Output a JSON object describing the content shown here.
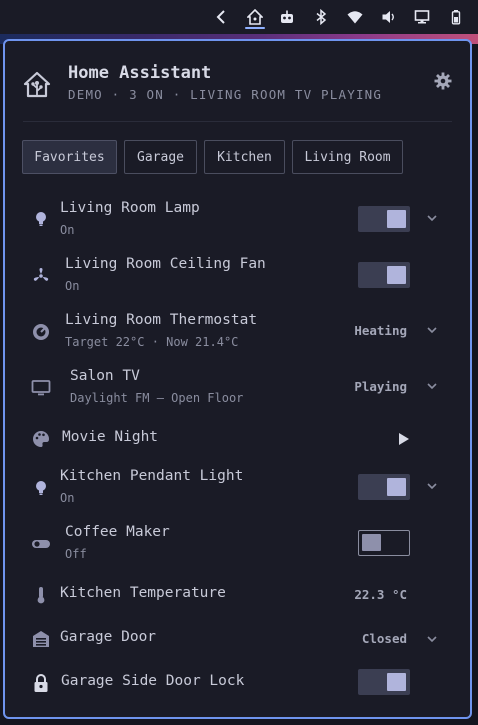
{
  "panel": {
    "title": "Home Assistant",
    "subtitle": "DEMO · 3 ON · LIVING ROOM TV PLAYING"
  },
  "tabs": [
    {
      "label": "Favorites",
      "active": true
    },
    {
      "label": "Garage",
      "active": false
    },
    {
      "label": "Kitchen",
      "active": false
    },
    {
      "label": "Living Room",
      "active": false
    }
  ],
  "entities": [
    {
      "icon": "lightbulb-icon",
      "name": "Living Room Lamp",
      "secondary": "On",
      "control": "toggle",
      "on": true,
      "expandable": true
    },
    {
      "icon": "fan-icon",
      "name": "Living Room Ceiling Fan",
      "secondary": "On",
      "control": "toggle",
      "on": true,
      "expandable": false
    },
    {
      "icon": "thermostat-icon",
      "name": "Living Room Thermostat",
      "secondary": "Target 22°C · Now 21.4°C",
      "control": "state",
      "state": "Heating",
      "expandable": true
    },
    {
      "icon": "tv-icon",
      "name": "Salon TV",
      "secondary": "Daylight FM — Open Floor",
      "control": "state",
      "state": "Playing",
      "expandable": true
    },
    {
      "icon": "palette-icon",
      "name": "Movie Night",
      "secondary": "",
      "control": "play",
      "expandable": false
    },
    {
      "icon": "lightbulb-icon",
      "name": "Kitchen Pendant Light",
      "secondary": "On",
      "control": "toggle",
      "on": true,
      "expandable": true
    },
    {
      "icon": "switch-icon",
      "name": "Coffee Maker",
      "secondary": "Off",
      "control": "toggle",
      "on": false,
      "expandable": false
    },
    {
      "icon": "thermometer-icon",
      "name": "Kitchen Temperature",
      "secondary": "",
      "control": "state",
      "state": "22.3 °C",
      "expandable": false
    },
    {
      "icon": "garage-icon",
      "name": "Garage Door",
      "secondary": "",
      "control": "state",
      "state": "Closed",
      "expandable": true
    },
    {
      "icon": "lock-icon",
      "name": "Garage Side Door Lock",
      "secondary": "",
      "control": "toggle",
      "on": true,
      "expandable": false
    }
  ],
  "colors": {
    "accent_border": "#6f94ee",
    "background": "#1a1b26",
    "toggle_on_knob": "#b0b4dc"
  }
}
